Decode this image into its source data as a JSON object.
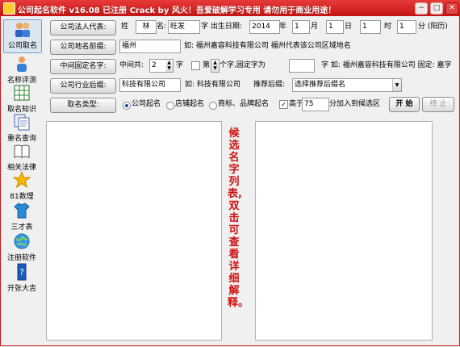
{
  "window": {
    "title": "公司起名软件 v16.08  已注册 Crack by 风火！吾爱破解学习专用 请勿用于商业用途！",
    "min": "−",
    "max": "□",
    "close": "✕"
  },
  "sidebar": {
    "items": [
      {
        "label": "公司取名",
        "icon": "people-icon"
      },
      {
        "label": "名称评测",
        "icon": "person-icon"
      },
      {
        "label": "取名知识",
        "icon": "grid-icon"
      },
      {
        "label": "重名查询",
        "icon": "documents-icon"
      },
      {
        "label": "相关法律",
        "icon": "book-icon"
      },
      {
        "label": "81数理",
        "icon": "star-icon"
      },
      {
        "label": "三才表",
        "icon": "shirt-icon"
      },
      {
        "label": "注册软件",
        "icon": "globe-icon"
      },
      {
        "label": "开张大吉",
        "icon": "banner-icon"
      }
    ]
  },
  "row1": {
    "button": "公司法人代表:",
    "surname_label": "姓",
    "surname": "林",
    "name_label": "名:",
    "name": "旺发",
    "birth_label": "字 出生日期:",
    "year": "2014",
    "year_unit": "年",
    "month": "1",
    "month_unit": "月",
    "day": "1",
    "day_unit": "日",
    "hour": "1",
    "hour_unit": "时",
    "minute": "1",
    "minute_unit": "分 (阳历)"
  },
  "row2": {
    "button": "公司地名前缀:",
    "value": "福州",
    "hint": "如: 福州嘉容科技有限公司 福州代表该公司区域地名"
  },
  "row3": {
    "button": "中间固定名字:",
    "middle_label": "中间共:",
    "middle_count": "2",
    "char_unit": "字",
    "nth_label": "第:",
    "nth_suffix": "个字,固定字为",
    "fixed_char": "",
    "hint": "字 如: 福州嘉容科技有限公司 固定: 嘉字"
  },
  "row4": {
    "button": "公司行业后缀:",
    "value": "科技有限公司",
    "hint": "如: 科技有限公司",
    "recommend_label": "推荐后缀:",
    "recommend_value": "选择推荐后缀名"
  },
  "row5": {
    "button": "取名类型:",
    "options": [
      "公司起名",
      "店铺起名",
      "商标、品牌起名"
    ],
    "selected": "公司起名",
    "threshold_prefix": "高于",
    "threshold": "75",
    "threshold_suffix": "分加入到候选区",
    "start": "开 始",
    "stop": "终 止"
  },
  "candidate_hint": "候选名字列表,双击可查看详细解释。"
}
